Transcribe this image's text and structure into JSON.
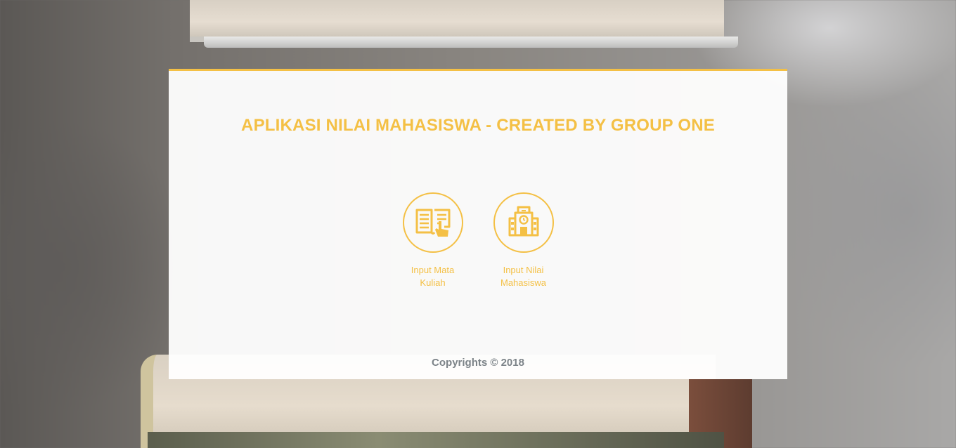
{
  "app": {
    "title": "APLIKASI NILAI MAHASISWA - CREATED BY GROUP ONE"
  },
  "menu": [
    {
      "label": "Input Mata Kuliah",
      "icon": "open-book-icon"
    },
    {
      "label": "Input Nilai Mahasiswa",
      "icon": "school-building-icon"
    }
  ],
  "footer": {
    "copyright": "Copyrights © 2018"
  },
  "colors": {
    "accent": "#f4c045",
    "footer_text": "#7c8388"
  }
}
